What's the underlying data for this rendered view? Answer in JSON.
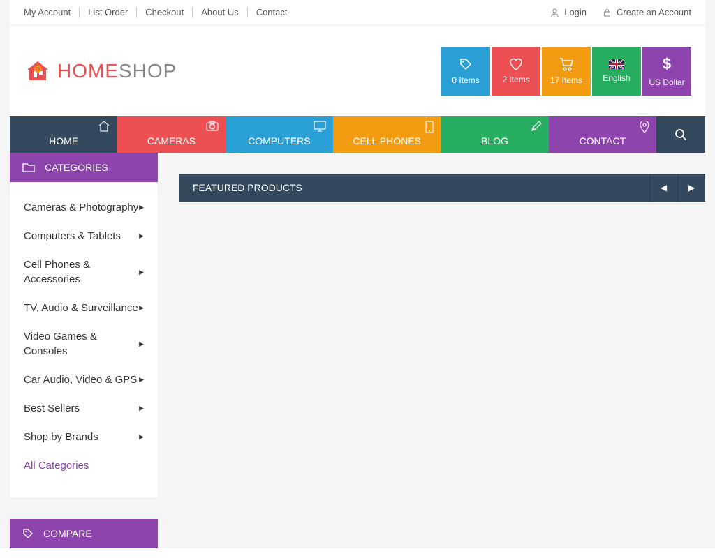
{
  "topbar": {
    "left_links": [
      "My Account",
      "List Order",
      "Checkout",
      "About Us",
      "Contact"
    ],
    "login": "Login",
    "create_account": "Create an Account"
  },
  "logo": {
    "home": "HOME",
    "shop": "SHOP"
  },
  "header_boxes": {
    "compare": "0 Items",
    "wishlist": "2 Items",
    "cart": "17 Items",
    "language": "English",
    "currency": "US Dollar"
  },
  "nav": {
    "home": "HOME",
    "cameras": "CAMERAS",
    "computers": "COMPUTERS",
    "cell": "CELL PHONES",
    "blog": "BLOG",
    "contact": "CONTACT"
  },
  "sidebar": {
    "categories_header": "CATEGORIES",
    "compare_header": "COMPARE",
    "categories": [
      "Cameras & Photography",
      "Computers & Tablets",
      "Cell Phones & Accessories",
      "TV, Audio & Surveillance",
      "Video Games & Consoles",
      "Car Audio, Video & GPS",
      "Best Sellers",
      "Shop by Brands"
    ],
    "all_categories": "All Categories"
  },
  "main": {
    "featured_title": "FEATURED PRODUCTS"
  }
}
